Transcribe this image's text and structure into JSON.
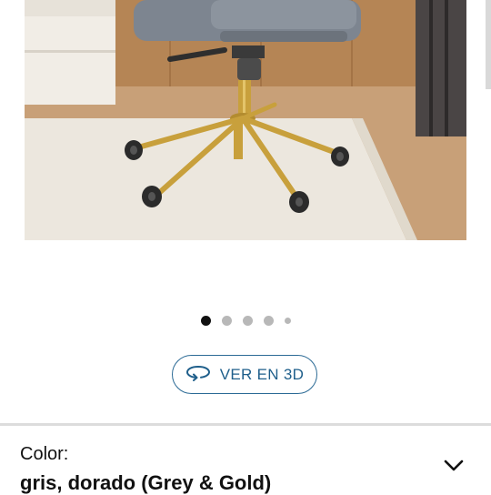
{
  "gallery": {
    "image_alt": "gris, dorado (Grey & Gold) office chair",
    "dots": [
      "active",
      "normal",
      "normal",
      "normal",
      "small"
    ]
  },
  "view_3d": {
    "label": "VER EN 3D",
    "icon": "rotate-3d-icon"
  },
  "variant": {
    "label": "Color:",
    "value": "gris, dorado (Grey & Gold)"
  },
  "colors": {
    "accent": "#1f5f8b",
    "chair_grey": "#7d8590",
    "gold": "#c8a03c"
  }
}
